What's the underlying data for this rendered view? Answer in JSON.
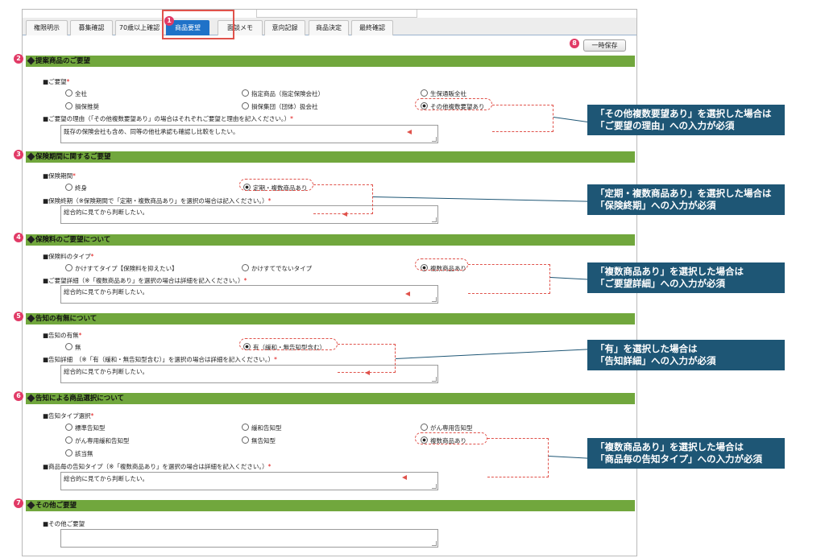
{
  "tabs": [
    "権限明示",
    "募集確認",
    "70歳以上確認",
    "商品要望",
    "面談メモ",
    "意向記録",
    "商品決定",
    "最終確認"
  ],
  "save_label": "一時保存",
  "markers": [
    "1",
    "2",
    "3",
    "4",
    "5",
    "6",
    "7",
    "8"
  ],
  "required_mark": "*",
  "s1": {
    "title": "提案商品のご要望",
    "label1": "■ご要望",
    "opts": [
      "全社",
      "指定商品（指定保険会社）",
      "生保通販全社",
      "損保推奨",
      "損保集団（団体）扱会社",
      "その他複数要望あり"
    ],
    "label2": "■ご要望の理由（「その他複数要望あり」の場合はそれぞれご要望と理由を記入ください。）",
    "value": "既存の保険会社も含め、同等の他社承認も確認し比較をしたい。"
  },
  "s2": {
    "title": "保険期間に関するご要望",
    "label1": "■保険期間",
    "opts": [
      "終身",
      "定期・複数商品あり"
    ],
    "label2": "■保険終期（※保険期間で「定期・複数商品あり」を選択の場合は記入ください。）",
    "value": "総合的に見てから判断したい。"
  },
  "s3": {
    "title": "保険料のご要望について",
    "label1": "■保険料のタイプ",
    "opts": [
      "かけすてタイプ【保険料を抑えたい】",
      "かけすてでないタイプ",
      "複数商品あり"
    ],
    "label2": "■ご要望詳細（※「複数商品あり」を選択の場合は詳細を記入ください。）",
    "value": "総合的に見てから判断したい。"
  },
  "s4": {
    "title": "告知の有無について",
    "label1": "■告知の有無",
    "opts": [
      "無",
      "有（緩和・無告知型含む）"
    ],
    "label2": "■告知詳細　（※「有（緩和・無告知型含む）」を選択の場合は詳細を記入ください。）",
    "value": "総合的に見てから判断したい。"
  },
  "s5": {
    "title": "告知による商品選択について",
    "label1": "■告知タイプ選択",
    "opts": [
      "標準告知型",
      "緩和告知型",
      "がん専用告知型",
      "がん専用緩和告知型",
      "無告知型",
      "複数商品あり",
      "該当無"
    ],
    "label2": "■商品毎の告知タイプ（※「複数商品あり」を選択の場合は詳細を記入ください。）",
    "value": "総合的に見てから判断したい。"
  },
  "s6": {
    "title": "その他ご要望",
    "label1": "■その他ご要望",
    "value": ""
  },
  "callouts": [
    {
      "line1": "「その他複数要望あり」を選択した場合は",
      "line2": "「ご要望の理由」への入力が必須"
    },
    {
      "line1": "「定期・複数商品あり」を選択した場合は",
      "line2": "「保険終期」への入力が必須"
    },
    {
      "line1": "「複数商品あり」を選択した場合は",
      "line2": "「ご要望詳細」への入力が必須"
    },
    {
      "line1": "「有」を選択した場合は",
      "line2": "「告知詳細」への入力が必須"
    },
    {
      "line1": "「複数商品あり」を選択した場合は",
      "line2": "「商品毎の告知タイプ」への入力が必須"
    }
  ],
  "colors": {
    "section_bg": "#71a73d",
    "callout_bg": "#1e5675",
    "marker": "#e13a66",
    "highlight": "#e0524b",
    "active_tab": "#1f72c8"
  },
  "selected": [
    "その他複数要望あり",
    "定期・複数商品あり",
    "複数商品あり",
    "有（緩和・無告知型含む）",
    "複数商品あり"
  ]
}
